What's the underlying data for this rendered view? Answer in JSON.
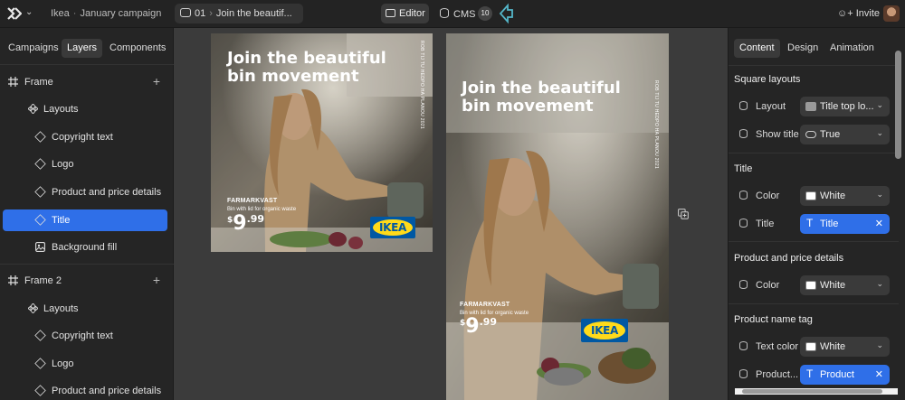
{
  "header": {
    "app_name": "Ikea",
    "separator": "·",
    "campaign": "January campaign",
    "frame_number": "01",
    "frame_name": "Join the beautif...",
    "editor_label": "Editor",
    "cms_label": "CMS",
    "cms_count": "10",
    "invite_label": "Invite"
  },
  "left_panel": {
    "tabs": [
      "Campaigns",
      "Layers",
      "Components"
    ],
    "active_tab": "Layers",
    "frames": [
      {
        "label": "Frame",
        "children": [
          {
            "label": "Layouts",
            "icon": "layouts-icon"
          },
          {
            "label": "Copyright text",
            "icon": "component-icon"
          },
          {
            "label": "Logo",
            "icon": "component-icon"
          },
          {
            "label": "Product and price details",
            "icon": "component-icon"
          },
          {
            "label": "Title",
            "icon": "component-icon",
            "selected": true
          },
          {
            "label": "Background fill",
            "icon": "image-icon"
          }
        ]
      },
      {
        "label": "Frame 2",
        "children": [
          {
            "label": "Layouts",
            "icon": "layouts-icon"
          },
          {
            "label": "Copyright text",
            "icon": "component-icon"
          },
          {
            "label": "Logo",
            "icon": "component-icon"
          },
          {
            "label": "Product and price details",
            "icon": "component-icon"
          }
        ]
      }
    ]
  },
  "canvas": {
    "ad_square": {
      "headline": "Join the beautiful bin movement",
      "vertical_text": "ROB TIJ TU HEDPO HA PLANOU 2021",
      "product_name": "FARMARKVAST",
      "product_desc": "Bin with lid for organic waste",
      "currency": "$",
      "price_main": "9",
      "price_cents": ".99",
      "logo_text": "IKEA"
    },
    "ad_tall": {
      "headline": "Join the beautiful bin movement",
      "vertical_text": "ROB TIJ TU HEDPO HA PLANOU 2021",
      "product_name": "FARMARKVAST",
      "product_desc": "Bin with lid for organic waste",
      "currency": "$",
      "price_main": "9",
      "price_cents": ".99",
      "logo_text": "IKEA"
    }
  },
  "right_panel": {
    "tabs": [
      "Content",
      "Design",
      "Animation"
    ],
    "active_tab": "Content",
    "sections": {
      "square_layouts": {
        "title": "Square layouts",
        "layout_label": "Layout",
        "layout_value": "Title top lo...",
        "show_title_label": "Show title",
        "show_title_value": "True"
      },
      "title": {
        "title": "Title",
        "color_label": "Color",
        "color_value": "White",
        "title_label": "Title",
        "title_value": "Title"
      },
      "product_price": {
        "title": "Product and price details",
        "color_label": "Color",
        "color_value": "White"
      },
      "product_name_tag": {
        "title": "Product name tag",
        "text_color_label": "Text color",
        "text_color_value": "White",
        "product_label": "Product...",
        "product_value": "Product"
      }
    },
    "colors": {
      "accent": "#2f6fe8",
      "swatch_white": "#ffffff",
      "swatch_gray": "#9a9a9a"
    }
  },
  "brand_colors": {
    "ikea_blue": "#0058a3",
    "ikea_yellow": "#ffda1a"
  }
}
